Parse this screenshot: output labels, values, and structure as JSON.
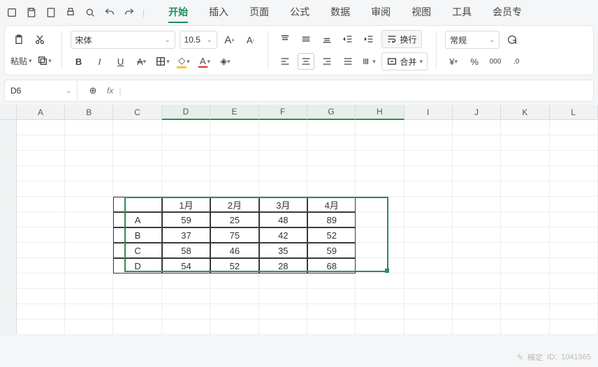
{
  "quick_access": {
    "sep": "|"
  },
  "menu": {
    "tabs": [
      "开始",
      "插入",
      "页面",
      "公式",
      "数据",
      "审阅",
      "视图",
      "工具",
      "会员专"
    ],
    "active_index": 0
  },
  "ribbon": {
    "clipboard": {
      "paste": "粘贴"
    },
    "font": {
      "name": "宋体",
      "size": "10.5",
      "bold": "B",
      "italic": "I",
      "underline": "U",
      "strike": "A",
      "fontcolor_letter": "A",
      "highlight_letter": "A"
    },
    "align": {
      "wrap": "换行",
      "merge": "合并"
    },
    "number": {
      "format": "常规",
      "currency": "¥",
      "percent": "%",
      "dec": "000",
      "comma": ".0"
    }
  },
  "namebox": {
    "ref": "D6"
  },
  "formula": {
    "fx": "fx",
    "value": ""
  },
  "grid": {
    "cols": [
      "A",
      "B",
      "C",
      "D",
      "E",
      "F",
      "G",
      "H",
      "I",
      "J",
      "K",
      "L"
    ],
    "selected_cols": [
      "D",
      "E",
      "F",
      "G",
      "H"
    ],
    "row_count": 14,
    "table": {
      "start_col": 2,
      "start_row": 5,
      "headers": [
        "",
        "1月",
        "2月",
        "3月",
        "4月"
      ],
      "rows": [
        [
          "A",
          "59",
          "25",
          "48",
          "89"
        ],
        [
          "B",
          "37",
          "75",
          "42",
          "52"
        ],
        [
          "C",
          "58",
          "46",
          "35",
          "59"
        ],
        [
          "D",
          "54",
          "52",
          "28",
          "68"
        ]
      ]
    },
    "selection": {
      "top_row": 5,
      "left_col": 2,
      "rows": 5,
      "cols": 5
    }
  },
  "chart_data": {
    "type": "table",
    "categories": [
      "1月",
      "2月",
      "3月",
      "4月"
    ],
    "series": [
      {
        "name": "A",
        "values": [
          59,
          25,
          48,
          89
        ]
      },
      {
        "name": "B",
        "values": [
          37,
          75,
          42,
          52
        ]
      },
      {
        "name": "C",
        "values": [
          58,
          46,
          35,
          59
        ]
      },
      {
        "name": "D",
        "values": [
          54,
          52,
          28,
          68
        ]
      }
    ]
  },
  "watermark": {
    "brand": "稿定",
    "id_label": "ID:",
    "id": "1041565"
  }
}
